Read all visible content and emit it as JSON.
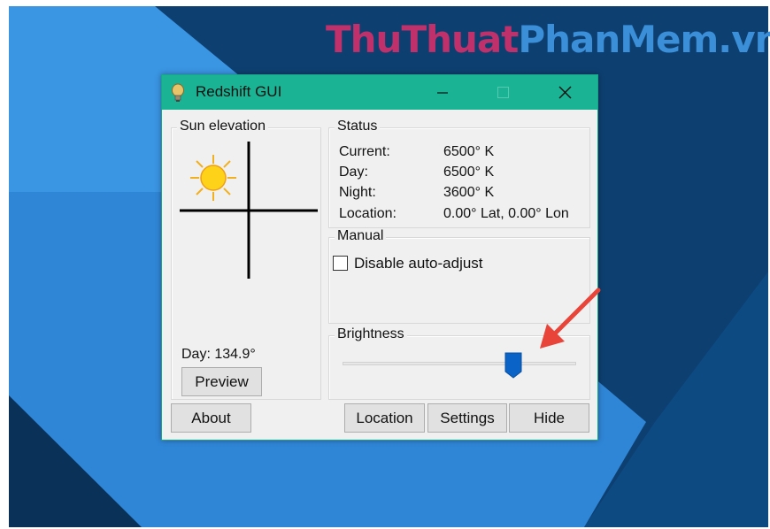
{
  "watermark": {
    "part1": "ThuThuat",
    "part2": "PhanMem.vn"
  },
  "window": {
    "title": "Redshift GUI",
    "controls": [
      "minimize",
      "maximize",
      "close"
    ]
  },
  "sun_elevation": {
    "label": "Sun elevation",
    "icon": "sun-icon",
    "day_text": "Day: 134.9°"
  },
  "status": {
    "label": "Status",
    "rows": [
      {
        "key": "Current:",
        "value": "6500° K"
      },
      {
        "key": "Day:",
        "value": "6500° K"
      },
      {
        "key": "Night:",
        "value": "3600° K"
      },
      {
        "key": "Location:",
        "value": "0.00° Lat, 0.00° Lon"
      }
    ]
  },
  "manual": {
    "label": "Manual",
    "checkbox_label": "Disable auto-adjust",
    "checked": false
  },
  "brightness": {
    "label": "Brightness",
    "level": 0.73
  },
  "buttons": {
    "preview": "Preview",
    "about": "About",
    "location": "Location",
    "settings": "Settings",
    "hide": "Hide"
  },
  "colors": {
    "titlebar": "#1ab394",
    "slider_thumb": "#0a64c8",
    "annotation_arrow": "#e8443a",
    "watermark_part1": "#c0306a",
    "watermark_part2": "#3a8fd8"
  }
}
